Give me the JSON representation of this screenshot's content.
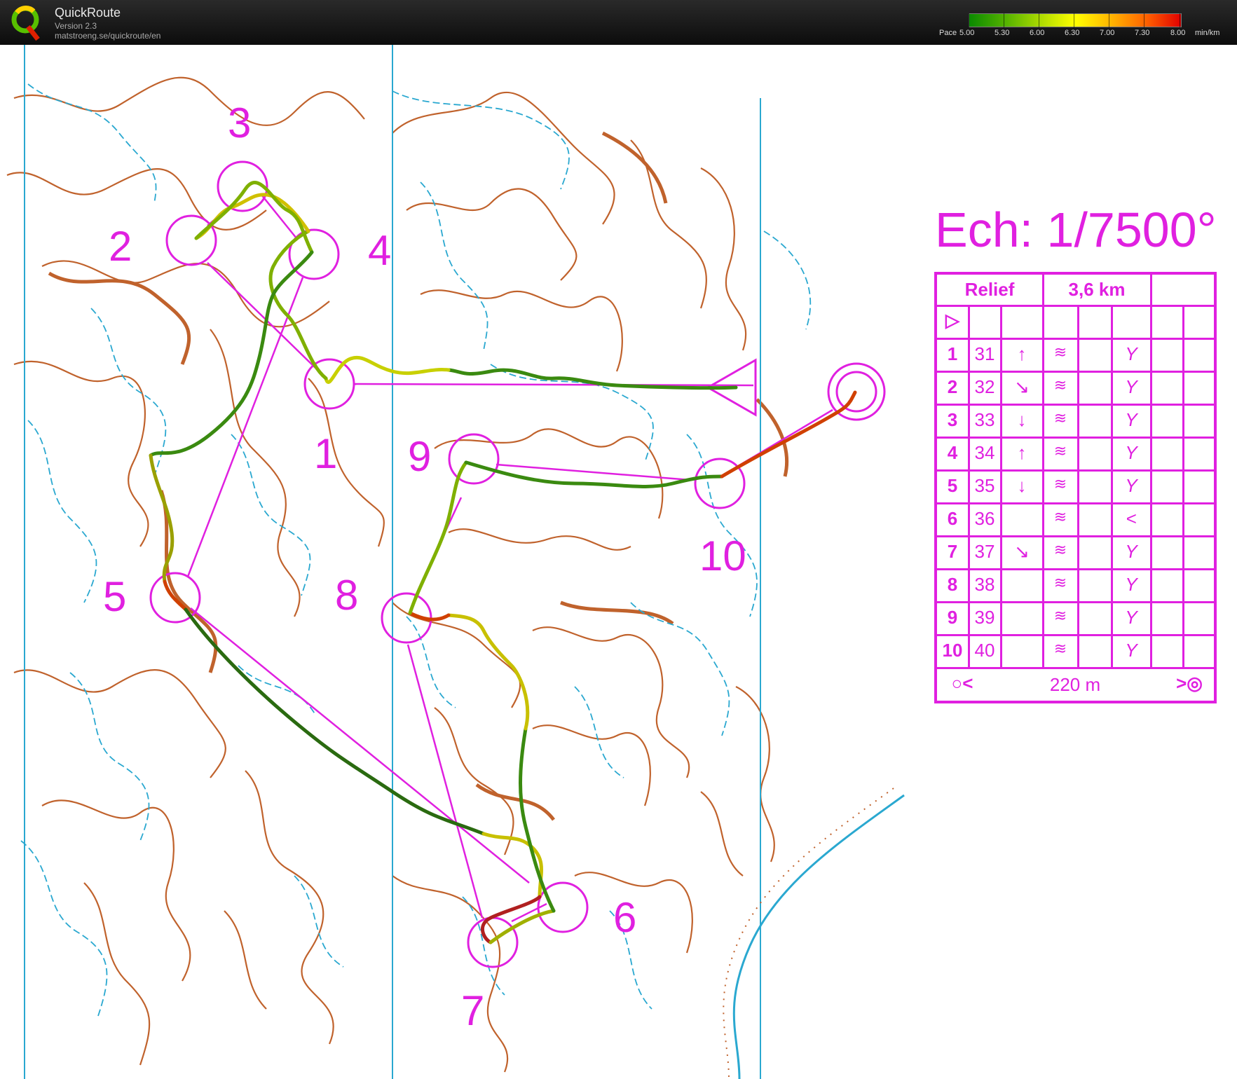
{
  "app": {
    "name": "QuickRoute",
    "version": "Version 2.3",
    "url": "matstroeng.se/quickroute/en"
  },
  "pace_legend": {
    "label": "Pace",
    "ticks": [
      "5.00",
      "5.30",
      "6.00",
      "6.30",
      "7.00",
      "7.30",
      "8.00"
    ],
    "unit": "min/km",
    "colors": [
      "#0a8a00",
      "#b9e000",
      "#ffff00",
      "#ff6000",
      "#e00000"
    ]
  },
  "map": {
    "scale_text": "Ech: 1/7500°",
    "colors": {
      "contour": "#c0622c",
      "water": "#2aa8d0",
      "course": "#e020e0",
      "grid": "#2aa8d0"
    },
    "control_labels": [
      "1",
      "2",
      "3",
      "4",
      "5",
      "6",
      "7",
      "8",
      "9",
      "10"
    ]
  },
  "description": {
    "header": {
      "class": "Relief",
      "length": "3,6 km"
    },
    "rows": [
      {
        "num": "1",
        "code": "31",
        "dir": "↑",
        "feature": "≋",
        "detail": "Y"
      },
      {
        "num": "2",
        "code": "32",
        "dir": "↘",
        "feature": "≋",
        "detail": "Y"
      },
      {
        "num": "3",
        "code": "33",
        "dir": "↓",
        "feature": "≋",
        "detail": "Y"
      },
      {
        "num": "4",
        "code": "34",
        "dir": "↑",
        "feature": "≋",
        "detail": "Y"
      },
      {
        "num": "5",
        "code": "35",
        "dir": "↓",
        "feature": "≋",
        "detail": "Y"
      },
      {
        "num": "6",
        "code": "36",
        "dir": "",
        "feature": "≋",
        "detail": "<"
      },
      {
        "num": "7",
        "code": "37",
        "dir": "↘",
        "feature": "≋",
        "detail": "Y"
      },
      {
        "num": "8",
        "code": "38",
        "dir": "",
        "feature": "≋",
        "detail": "Y"
      },
      {
        "num": "9",
        "code": "39",
        "dir": "",
        "feature": "≋",
        "detail": "Y"
      },
      {
        "num": "10",
        "code": "40",
        "dir": "",
        "feature": "≋",
        "detail": "Y"
      }
    ],
    "footer": {
      "distance": "220 m"
    }
  }
}
